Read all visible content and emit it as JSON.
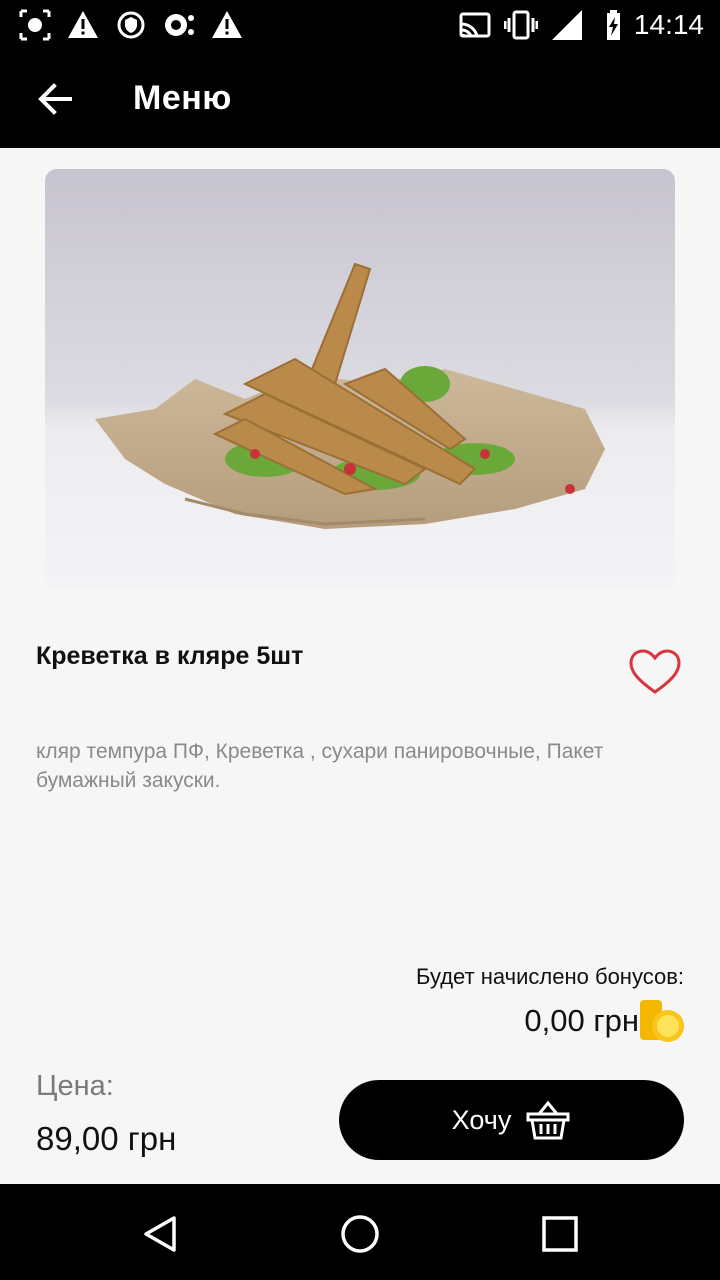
{
  "status_bar": {
    "time": "14:14",
    "left_icons": [
      "screenshot-icon",
      "warning-icon",
      "vpn-icon",
      "screenshot-icon",
      "warning-icon"
    ],
    "right_icons": [
      "cast-icon",
      "vibrate-icon",
      "signal-icon",
      "battery-icon"
    ]
  },
  "app_bar": {
    "title": "Меню",
    "back_icon": "arrow-back-icon"
  },
  "product": {
    "image": "fried-shrimp-photo",
    "name": "Креветка в кляре 5шт",
    "favorite_icon": "heart-outline-icon",
    "ingredients": "кляр темпура ПФ, Креветка , сухари панировочные, Пакет бумажный закуски."
  },
  "bonus": {
    "label": "Будет начислено бонусов:",
    "value": "0,00 грн",
    "icon": "coins-icon"
  },
  "price": {
    "label": "Цена:",
    "value": "89,00 грн"
  },
  "cta": {
    "label": "Хочу",
    "icon": "basket-icon"
  },
  "colors": {
    "bar_background": "#000000",
    "page_background": "#f6f6f6",
    "heart": "#d8343c",
    "coin": "#f5b800"
  },
  "nav_bar": {
    "icons": [
      "back-triangle-icon",
      "home-circle-icon",
      "recents-square-icon"
    ]
  }
}
